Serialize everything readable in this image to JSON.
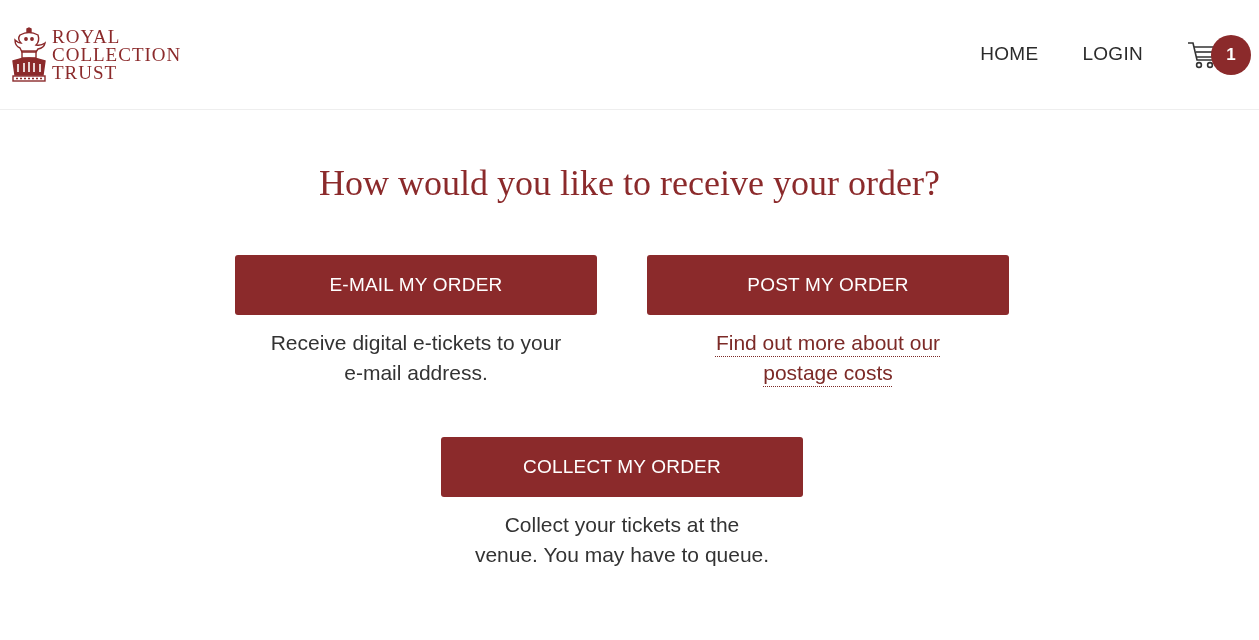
{
  "header": {
    "logo": {
      "text": "ROYAL COLLECTION TRUST"
    },
    "nav": [
      {
        "label": "HOME"
      },
      {
        "label": "LOGIN"
      }
    ],
    "cart": {
      "count": "1"
    }
  },
  "heading": "How would you like to receive your order?",
  "options": [
    {
      "button": "E-MAIL MY ORDER",
      "kind": "text",
      "description": "Receive digital e-tickets to your e-mail address."
    },
    {
      "button": "POST MY ORDER",
      "kind": "link",
      "description": "Find out more about our postage costs"
    },
    {
      "button": "COLLECT MY ORDER",
      "kind": "text",
      "description": "Collect your tickets at the venue. You may have to queue."
    }
  ]
}
